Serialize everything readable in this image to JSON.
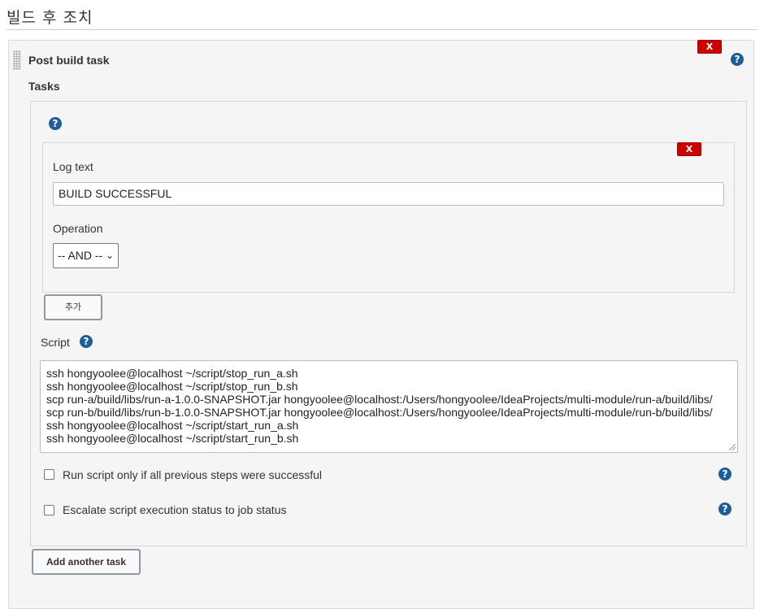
{
  "section": {
    "title": "빌드 후 조치"
  },
  "post_build": {
    "title": "Post build task",
    "delete_label": "X",
    "tasks_label": "Tasks"
  },
  "task": {
    "delete_label": "X",
    "log_text_label": "Log text",
    "log_text_value": "BUILD SUCCESSFUL",
    "operation_label": "Operation",
    "operation_value": "-- AND --",
    "add_label": "추가",
    "script_label": "Script",
    "script_lines": [
      "ssh hongyoolee@localhost ~/script/stop_run_a.sh",
      "ssh hongyoolee@localhost ~/script/stop_run_b.sh",
      "scp run-a/build/libs/run-a-1.0.0-SNAPSHOT.jar hongyoolee@localhost:/Users/hongyoolee/IdeaProjects/multi-module/run-a/build/libs/",
      "scp run-b/build/libs/run-b-1.0.0-SNAPSHOT.jar hongyoolee@localhost:/Users/hongyoolee/IdeaProjects/multi-module/run-b/build/libs/",
      "ssh hongyoolee@localhost ~/script/start_run_a.sh",
      "ssh hongyoolee@localhost ~/script/start_run_b.sh"
    ],
    "run_if_success_label": "Run script only if all previous steps were successful",
    "escalate_label": "Escalate script execution status to job status"
  },
  "add_task_label": "Add another task",
  "help_glyph": "?",
  "colors": {
    "delete": "#cc0000",
    "help": "#1f5d99"
  }
}
